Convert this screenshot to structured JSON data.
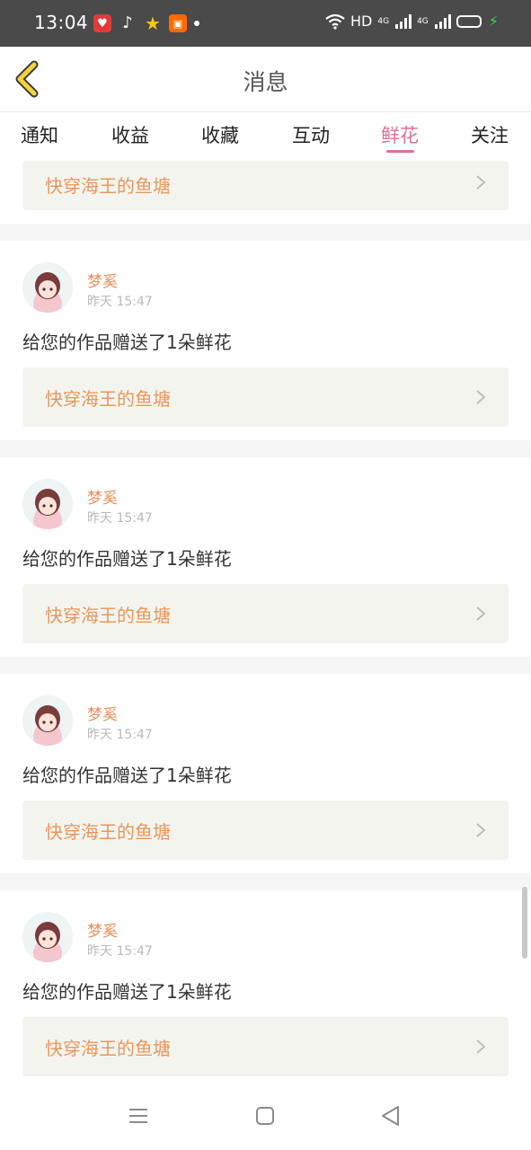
{
  "status_bar": {
    "time": "13:04",
    "notification_icons": [
      "heart-app-icon",
      "tiktok-icon",
      "star-icon",
      "app-icon"
    ],
    "hd": "HD",
    "net1": "4G",
    "net2": "4G",
    "battery_charging": true
  },
  "header": {
    "title": "消息",
    "back_icon": "chevron-left-icon",
    "accent": "#f5d33a"
  },
  "tabs": [
    {
      "label": "通知",
      "active": false
    },
    {
      "label": "收益",
      "active": false
    },
    {
      "label": "收藏",
      "active": false
    },
    {
      "label": "互动",
      "active": false
    },
    {
      "label": "鲜花",
      "active": true
    },
    {
      "label": "关注",
      "active": false
    }
  ],
  "active_tab_color": "#e06f9b",
  "messages": {
    "partial_book_title": "快穿海王的鱼塘",
    "items": [
      {
        "username": "梦奚",
        "time": "昨天 15:47",
        "text": "给您的作品赠送了1朵鲜花",
        "book_title": "快穿海王的鱼塘"
      },
      {
        "username": "梦奚",
        "time": "昨天 15:47",
        "text": "给您的作品赠送了1朵鲜花",
        "book_title": "快穿海王的鱼塘"
      },
      {
        "username": "梦奚",
        "time": "昨天 15:47",
        "text": "给您的作品赠送了1朵鲜花",
        "book_title": "快穿海王的鱼塘"
      },
      {
        "username": "梦奚",
        "time": "昨天 15:47",
        "text": "给您的作品赠送了1朵鲜花",
        "book_title": "快穿海王的鱼塘"
      }
    ]
  },
  "nav_bar": {
    "icons": [
      "menu-icon",
      "home-icon",
      "back-icon"
    ]
  }
}
